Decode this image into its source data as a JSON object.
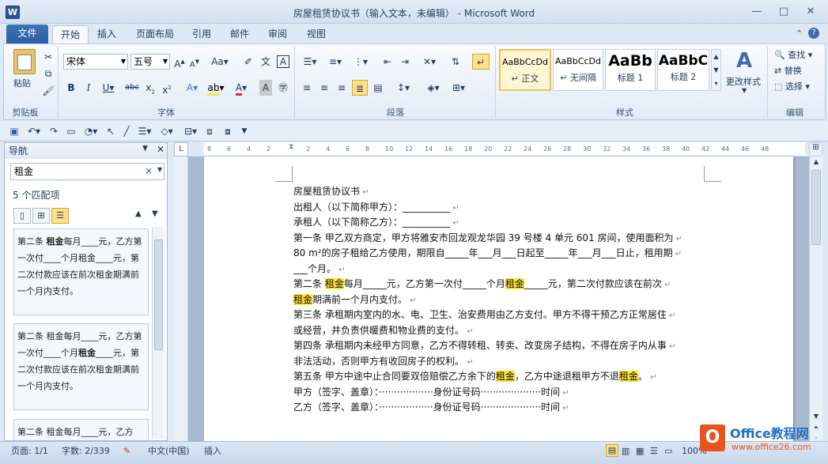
{
  "window": {
    "title": "房屋租赁协议书（输入文本，未编辑） - Microsoft Word",
    "app_icon": "W"
  },
  "tabs": [
    "文件",
    "开始",
    "插入",
    "页面布局",
    "引用",
    "邮件",
    "审阅",
    "视图"
  ],
  "ribbon": {
    "clipboard": {
      "paste": "粘贴",
      "label": "剪贴板"
    },
    "font": {
      "name": "宋体",
      "size": "五号",
      "label": "字体"
    },
    "paragraph": {
      "label": "段落"
    },
    "styles": {
      "items": [
        {
          "preview": "AaBbCcDd",
          "name": "↵ 正文"
        },
        {
          "preview": "AaBbCcDd",
          "name": "↵ 无间隔"
        },
        {
          "preview": "AaBb",
          "name": "标题 1"
        },
        {
          "preview": "AaBbC",
          "name": "标题 2"
        }
      ],
      "change": "更改样式",
      "label": "样式"
    },
    "editing": {
      "find": "查找",
      "replace": "替换",
      "select": "选择",
      "label": "编辑"
    }
  },
  "nav": {
    "title": "导航",
    "search_value": "租金",
    "count": "5 个匹配项",
    "results": [
      {
        "pre": "第二条 ",
        "hit": "租金",
        "post": "每月____元，乙方第一次付____个月租金____元，第二次付款应该在前次租金期满前一个月内支付。"
      },
      {
        "pre": "第二条 租金每月____元，乙方第一次付____个月",
        "hit": "租金",
        "post": "____元，第二次付款应该在前次租金期满前一个月内支付。"
      },
      {
        "pre": "第二条 租金每月____元，乙方",
        "hit": "",
        "post": ""
      }
    ]
  },
  "ruler_ticks": [
    "8",
    "6",
    "4",
    "2",
    "",
    "2",
    "4",
    "6",
    "8",
    "10",
    "12",
    "14",
    "16",
    "18",
    "20",
    "22",
    "24",
    "26",
    "28",
    "30",
    "32",
    "34",
    "36",
    "38",
    "40",
    "42",
    "44",
    "46",
    "48"
  ],
  "document": {
    "lines": [
      [
        {
          "t": "房屋租赁协议书"
        }
      ],
      [
        {
          "t": "出租人（以下简称甲方）：__________"
        }
      ],
      [
        {
          "t": "承租人（以下简称乙方）：__________"
        }
      ],
      [
        {
          "t": "第一条  甲乙双方商定，甲方将雅安市回龙观龙华园 39 号楼 4 单元 601 房间，使用面积为"
        }
      ],
      [
        {
          "t": "80 m²的房子租给乙方使用，期限自_____年___月___日起至_____年___月___日止，租用期"
        }
      ],
      [
        {
          "t": "___个月。"
        }
      ],
      [
        {
          "t": "第二条  "
        },
        {
          "t": "租金",
          "h": true
        },
        {
          "t": "每月_____元，乙方第一次付_____个月"
        },
        {
          "t": "租金",
          "h": true
        },
        {
          "t": "_____元，第二次付款应该在前次"
        }
      ],
      [
        {
          "t": "租金",
          "h": true
        },
        {
          "t": "期满前一个月内支付。"
        }
      ],
      [
        {
          "t": "第三条  承租期内室内的水、电、卫生、治安费用由乙方支付。甲方不得干预乙方正常居住"
        }
      ],
      [
        {
          "t": "或经营，并负责供暖费和物业费的支付。"
        }
      ],
      [
        {
          "t": "第四条  承租期内未经甲方同意，乙方不得转租、转卖、改变房子结构，不得在房子内从事"
        }
      ],
      [
        {
          "t": "非法活动，否则甲方有收回房子的权利。"
        }
      ],
      [
        {
          "t": "第五条  甲方中途中止合同要双倍赔偿乙方余下的"
        },
        {
          "t": "租金",
          "h": true
        },
        {
          "t": "，乙方中途退租甲方不退"
        },
        {
          "t": "租金",
          "h": true
        },
        {
          "t": "。"
        }
      ],
      [
        {
          "t": "甲方（签字、盖章）：··················身份证号码····················时间"
        }
      ],
      [
        {
          "t": "乙方（签字、盖章）：··················身份证号码····················时间"
        }
      ]
    ]
  },
  "status": {
    "page": "页面: 1/1",
    "words": "字数: 2/339",
    "language": "中文(中国)",
    "mode": "插入",
    "zoom": "100%"
  },
  "watermark": {
    "brand": "Office教程网",
    "url": "www.office26.com"
  }
}
